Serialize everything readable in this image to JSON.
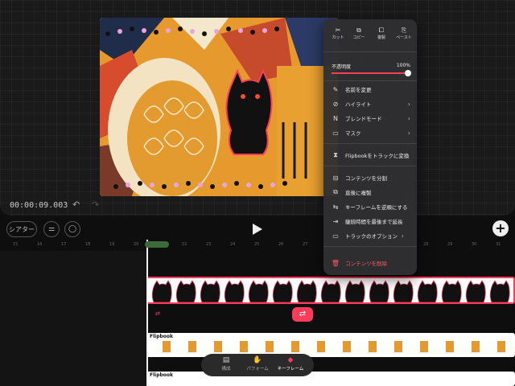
{
  "viewer": {
    "timecode": "00:00:09.003",
    "undo_icon": "undo-icon",
    "redo_icon": "redo-icon"
  },
  "toolbar": {
    "theater_label": "シアター",
    "settings_icon": "sliders-icon",
    "comment_icon": "speech-bubble-icon",
    "play_icon": "play-icon",
    "add_icon": "plus-icon"
  },
  "ruler": {
    "ticks": [
      "15",
      "16",
      "17",
      "18",
      "19",
      "20",
      "21",
      "22",
      "23",
      "24",
      "25",
      "26",
      "27",
      "28",
      "29",
      "30",
      "31"
    ]
  },
  "tracks": {
    "flipbook1_label": "Flipbook",
    "flipbook2_label": "Flipbook"
  },
  "bottom_bar": {
    "items": [
      {
        "label": "構成",
        "icon": "layers-icon"
      },
      {
        "label": "パフォーム",
        "icon": "hand-icon"
      },
      {
        "label": "キーフレーム",
        "icon": "keyframe-icon"
      }
    ]
  },
  "menu": {
    "top_actions": [
      {
        "label": "カット",
        "icon": "scissors-icon"
      },
      {
        "label": "コピー",
        "icon": "copy-icon"
      },
      {
        "label": "複製",
        "icon": "duplicate-icon"
      },
      {
        "label": "ペースト",
        "icon": "paste-icon"
      }
    ],
    "opacity_label": "不透明度",
    "opacity_value": "100%",
    "opacity_fraction": 1.0,
    "items": [
      {
        "label": "名前を変更",
        "icon": "pencil-icon"
      },
      {
        "label": "ハイライト",
        "icon": "highlight-icon"
      },
      {
        "label": "ブレンドモード",
        "icon": "blend-icon"
      },
      {
        "label": "マスク",
        "icon": "mask-icon"
      },
      {
        "label": "Flipbookをトラックに変換",
        "icon": "convert-icon"
      },
      {
        "label": "コンテンツを分割",
        "icon": "split-icon"
      },
      {
        "label": "直後に複製",
        "icon": "duplicate-after-icon"
      },
      {
        "label": "キーフレームを逆順にする",
        "icon": "reverse-icon"
      },
      {
        "label": "継続時間を最後まで延長",
        "icon": "extend-icon"
      },
      {
        "label": "トラックのオプション",
        "icon": "track-options-icon"
      },
      {
        "label": "コンテンツを削除",
        "icon": "trash-icon"
      }
    ]
  },
  "colors": {
    "accent": "#ff3b5c",
    "menu_bg": "#303032"
  }
}
